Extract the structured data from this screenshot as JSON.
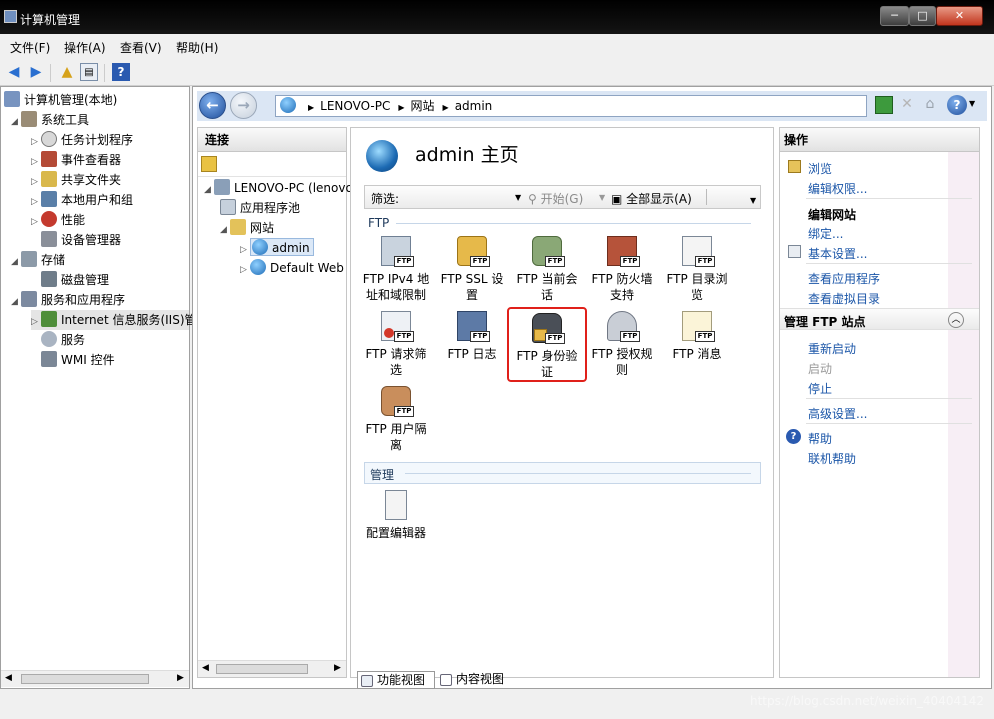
{
  "window": {
    "title": "计算机管理",
    "min": "─",
    "max": "□",
    "close": "✕"
  },
  "menu": [
    "文件(F)",
    "操作(A)",
    "查看(V)",
    "帮助(H)"
  ],
  "tree": {
    "root": "计算机管理(本地)",
    "system_tools": "系统工具",
    "task_scheduler": "任务计划程序",
    "event_viewer": "事件查看器",
    "shared_folders": "共享文件夹",
    "local_users": "本地用户和组",
    "performance": "性能",
    "device_manager": "设备管理器",
    "storage": "存储",
    "disk_management": "磁盘管理",
    "services_apps": "服务和应用程序",
    "iis": "Internet 信息服务(IIS)管",
    "services": "服务",
    "wmi": "WMI 控件"
  },
  "breadcrumb": [
    "LENOVO-PC",
    "网站",
    "admin"
  ],
  "connections": {
    "title": "连接",
    "server": "LENOVO-PC (lenovo",
    "app_pools": "应用程序池",
    "sites": "网站",
    "site_admin": "admin",
    "site_default": "Default Web"
  },
  "home": {
    "title": "admin 主页"
  },
  "filter": {
    "label": "筛选:",
    "go": "开始(G)",
    "show_all": "全部显示(A)"
  },
  "groups": {
    "ftp": "FTP",
    "manage": "管理"
  },
  "features": [
    {
      "l1": "FTP IPv4 地",
      "l2": "址和域限制"
    },
    {
      "l1": "FTP SSL 设",
      "l2": "置"
    },
    {
      "l1": "FTP 当前会",
      "l2": "话"
    },
    {
      "l1": "FTP 防火墙",
      "l2": "支持"
    },
    {
      "l1": "FTP 目录浏",
      "l2": "览"
    },
    {
      "l1": "FTP 请求筛",
      "l2": "选"
    },
    {
      "l1": "FTP 日志",
      "l2": ""
    },
    {
      "l1": "FTP 身份验",
      "l2": "证"
    },
    {
      "l1": "FTP 授权规",
      "l2": "则"
    },
    {
      "l1": "FTP 消息",
      "l2": ""
    },
    {
      "l1": "FTP 用户隔",
      "l2": "离"
    }
  ],
  "config_editor": "配置编辑器",
  "ftp_badge": "FTP",
  "view_tabs": {
    "features": "功能视图",
    "content": "内容视图"
  },
  "actions": {
    "title": "操作",
    "browse": "浏览",
    "edit_permissions": "编辑权限...",
    "edit_site": "编辑网站",
    "bindings": "绑定...",
    "basic_settings": "基本设置...",
    "view_apps": "查看应用程序",
    "view_vdirs": "查看虚拟目录",
    "manage_ftp": "管理 FTP 站点",
    "restart": "重新启动",
    "start": "启动",
    "stop": "停止",
    "advanced": "高级设置...",
    "help": "帮助",
    "online_help": "联机帮助"
  },
  "watermark": "https://blog.csdn.net/weixin_40404142"
}
